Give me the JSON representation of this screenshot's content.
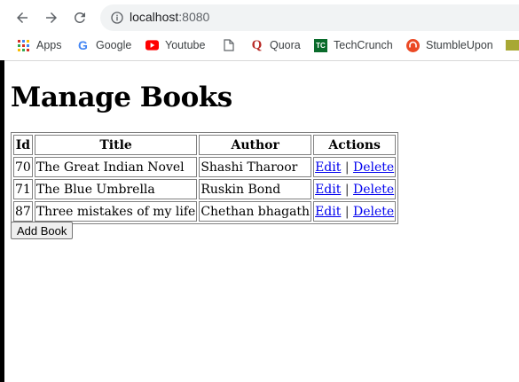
{
  "browser": {
    "url_host": "localhost",
    "url_port": ":8080",
    "bookmarks": [
      {
        "label": "Apps",
        "icon": "apps-grid-icon"
      },
      {
        "label": "Google",
        "icon": "google-icon"
      },
      {
        "label": "Youtube",
        "icon": "youtube-icon"
      },
      {
        "label": "",
        "icon": "page-icon"
      },
      {
        "label": "Quora",
        "icon": "quora-icon"
      },
      {
        "label": "TechCrunch",
        "icon": "techcrunch-icon"
      },
      {
        "label": "StumbleUpon",
        "icon": "stumbleupon-icon"
      }
    ]
  },
  "page": {
    "title": "Manage Books",
    "table": {
      "headers": [
        "Id",
        "Title",
        "Author",
        "Actions"
      ],
      "rows": [
        {
          "id": "70",
          "title": "The Great Indian Novel",
          "author": "Shashi Tharoor"
        },
        {
          "id": "71",
          "title": "The Blue Umbrella",
          "author": "Ruskin Bond"
        },
        {
          "id": "87",
          "title": "Three mistakes of my life",
          "author": "Chethan bhagath"
        }
      ],
      "edit_label": "Edit",
      "separator": "|",
      "delete_label": "Delete"
    },
    "add_button_label": "Add Book"
  }
}
